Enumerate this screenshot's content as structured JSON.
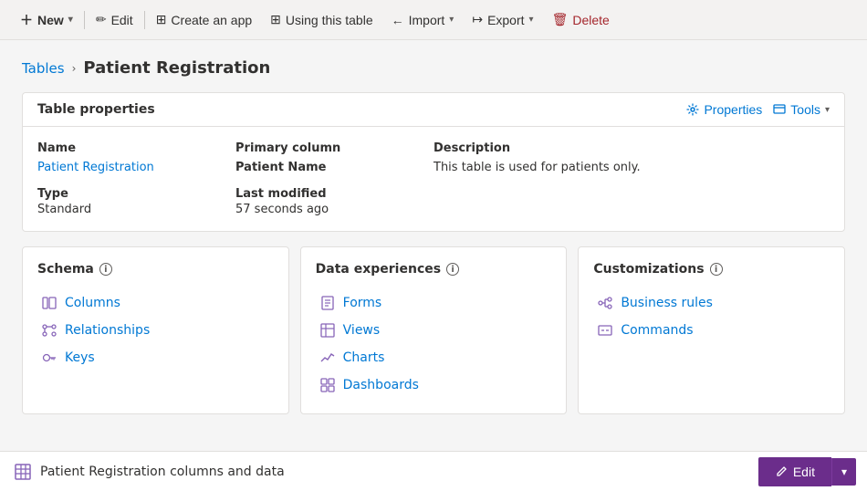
{
  "toolbar": {
    "new_label": "New",
    "edit_label": "Edit",
    "create_app_label": "Create an app",
    "using_this_table_label": "Using this table",
    "import_label": "Import",
    "export_label": "Export",
    "delete_label": "Delete"
  },
  "breadcrumb": {
    "parent": "Tables",
    "separator": "›",
    "current": "Patient Registration"
  },
  "table_properties": {
    "title": "Table properties",
    "properties_label": "Properties",
    "tools_label": "Tools",
    "name_label": "Name",
    "name_value": "Patient Registration",
    "type_label": "Type",
    "type_value": "Standard",
    "primary_column_label": "Primary column",
    "primary_column_value": "Patient Name",
    "last_modified_label": "Last modified",
    "last_modified_value": "57 seconds ago",
    "description_label": "Description",
    "description_value": "This table is used for patients only."
  },
  "schema": {
    "title": "Schema",
    "info": "i",
    "items": [
      {
        "label": "Columns",
        "icon": "columns-icon"
      },
      {
        "label": "Relationships",
        "icon": "relationships-icon"
      },
      {
        "label": "Keys",
        "icon": "keys-icon"
      }
    ]
  },
  "data_experiences": {
    "title": "Data experiences",
    "info": "i",
    "items": [
      {
        "label": "Forms",
        "icon": "forms-icon"
      },
      {
        "label": "Views",
        "icon": "views-icon"
      },
      {
        "label": "Charts",
        "icon": "charts-icon"
      },
      {
        "label": "Dashboards",
        "icon": "dashboards-icon"
      }
    ]
  },
  "customizations": {
    "title": "Customizations",
    "info": "i",
    "items": [
      {
        "label": "Business rules",
        "icon": "business-rules-icon"
      },
      {
        "label": "Commands",
        "icon": "commands-icon"
      }
    ]
  },
  "bottom_bar": {
    "table_label": "Patient Registration columns and data",
    "edit_label": "Edit"
  }
}
